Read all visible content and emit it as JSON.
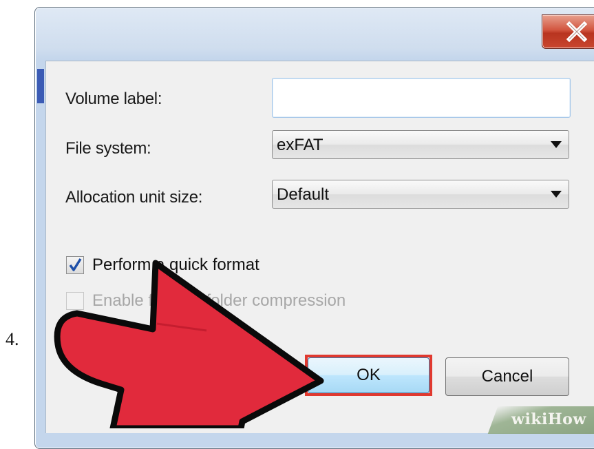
{
  "step_number": "4.",
  "window": {
    "close_glyph": "X"
  },
  "form": {
    "volume_label": {
      "label": "Volume label:",
      "value": ""
    },
    "file_system": {
      "label": "File system:",
      "value": "exFAT"
    },
    "allocation_unit": {
      "label": "Allocation unit size:",
      "value": "Default"
    }
  },
  "options": {
    "quick_format": {
      "label": "Perform a quick format",
      "checked": true
    },
    "compression": {
      "label": "Enable file and folder compression",
      "checked": false,
      "disabled": true
    }
  },
  "buttons": {
    "ok": "OK",
    "cancel": "Cancel"
  },
  "watermark": {
    "text": "wikiHow"
  },
  "colors": {
    "highlight": "#e0392f",
    "arrow": "#e12a3c",
    "checkmark": "#1e4fa8"
  },
  "icons": {
    "close": "close-icon",
    "dropdown": "chevron-down-icon",
    "check": "checkmark-icon",
    "pointer": "pointer-arrow-icon"
  }
}
